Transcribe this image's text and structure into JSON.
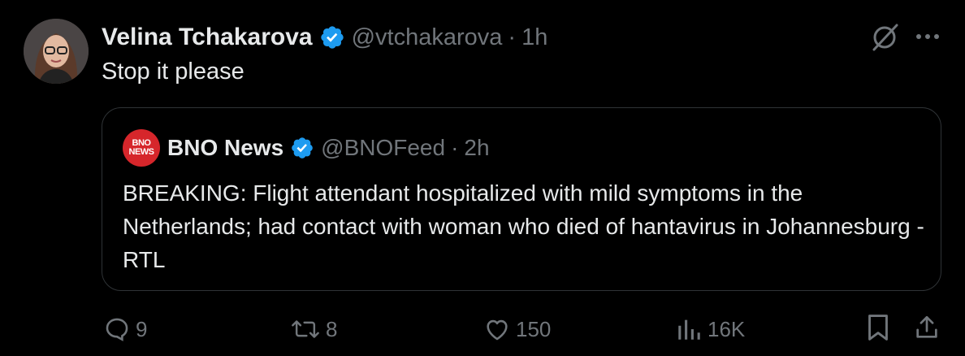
{
  "tweet": {
    "author_name": "Velina Tchakarova",
    "handle": "@vtchakarova",
    "separator": "·",
    "time": "1h",
    "text": "Stop it please",
    "verified": true
  },
  "quoted_tweet": {
    "logo_top": "BNO",
    "logo_bottom": "NEWS",
    "author_name": "BNO News",
    "handle": "@BNOFeed",
    "separator": "·",
    "time": "2h",
    "text": "BREAKING: Flight attendant hospitalized with mild symptoms in the Netherlands; had contact with woman who died of hantavirus in Johannesburg - RTL",
    "verified": true
  },
  "actions": {
    "replies": "9",
    "reposts": "8",
    "likes": "150",
    "views": "16K"
  },
  "icons": {
    "grok": "grok-icon",
    "more": "more-icon",
    "reply": "reply-icon",
    "repost": "repost-icon",
    "like": "heart-icon",
    "views": "views-icon",
    "bookmark": "bookmark-icon",
    "share": "share-icon"
  },
  "colors": {
    "background": "#000000",
    "text_primary": "#e7e9ea",
    "text_secondary": "#71767b",
    "verified_blue": "#1d9bf0",
    "border": "#2f3336",
    "bno_red": "#d6262b"
  }
}
